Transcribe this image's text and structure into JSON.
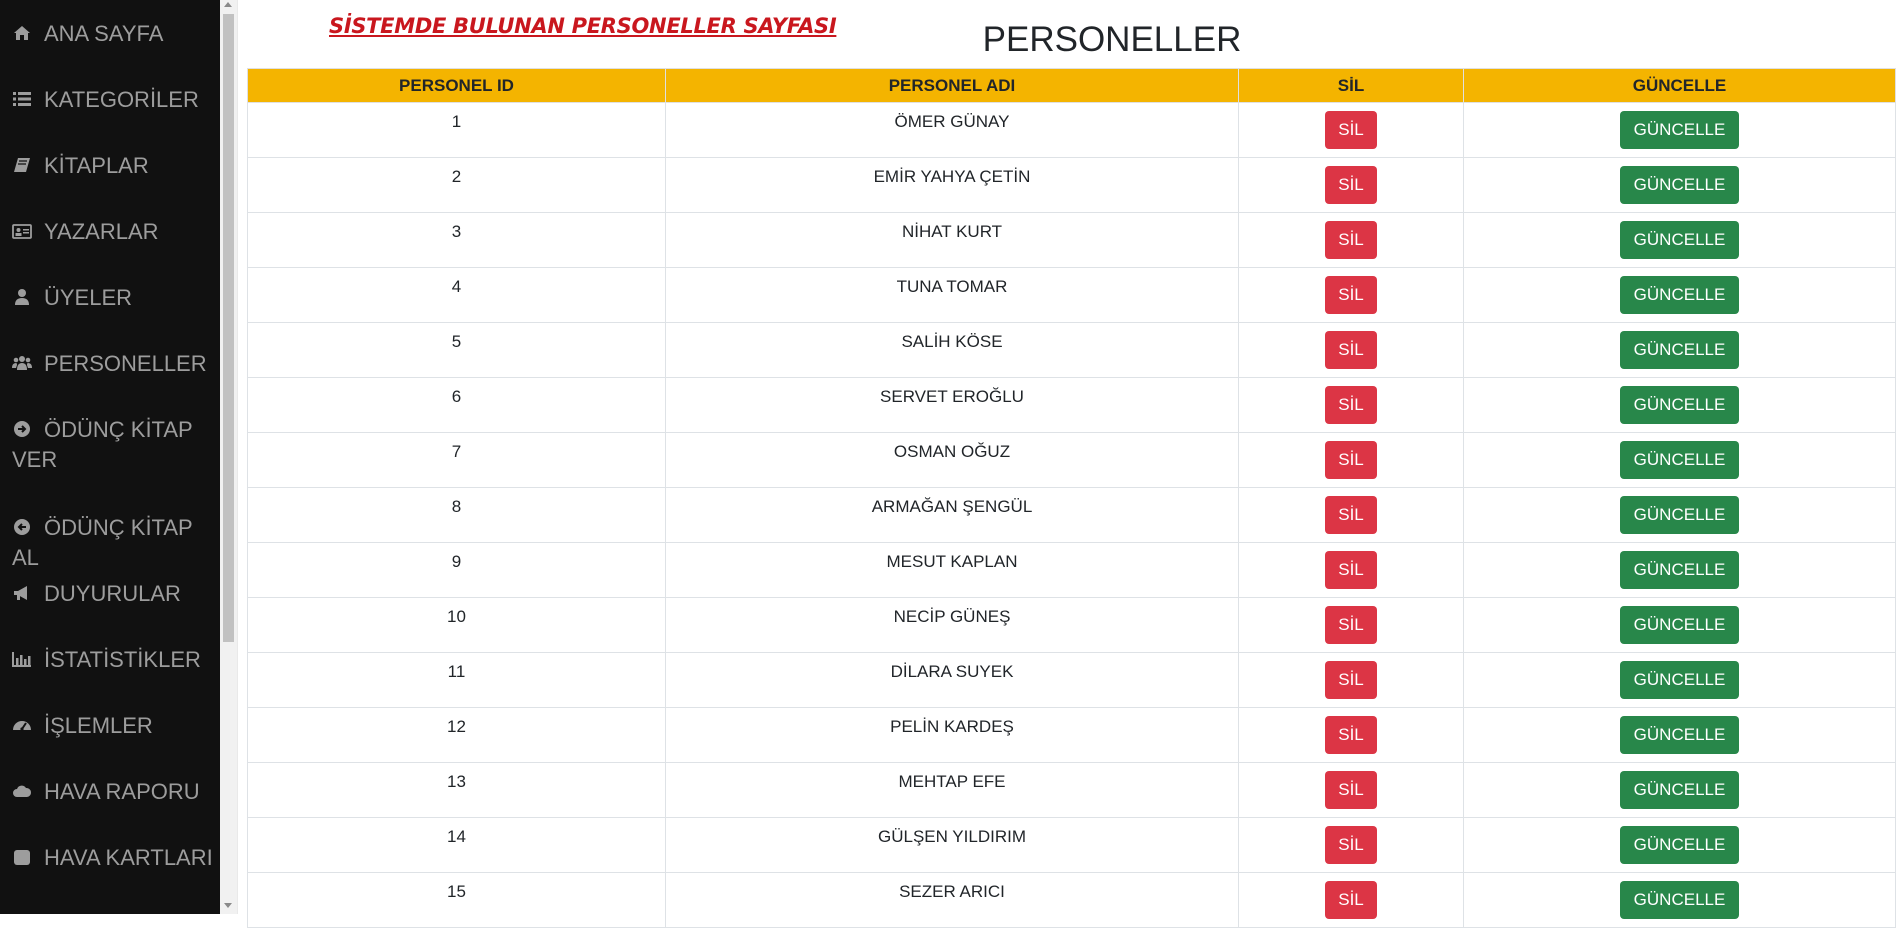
{
  "sidebar": {
    "items": [
      {
        "label": "ANA SAYFA",
        "icon": "home-icon"
      },
      {
        "label": "KATEGORİLER",
        "icon": "list-icon"
      },
      {
        "label": "KİTAPLAR",
        "icon": "book-icon"
      },
      {
        "label": "YAZARLAR",
        "icon": "id-card-icon"
      },
      {
        "label": "ÜYELER",
        "icon": "user-icon"
      },
      {
        "label": "PERSONELLER",
        "icon": "users-icon"
      },
      {
        "label": "ÖDÜNÇ KİTAP VER",
        "icon": "arrow-circle-right-icon"
      },
      {
        "label": "ÖDÜNÇ KİTAP AL",
        "icon": "arrow-circle-left-icon"
      },
      {
        "label": "DUYURULAR",
        "icon": "bullhorn-icon"
      },
      {
        "label": "İSTATİSTİKLER",
        "icon": "bar-chart-icon"
      },
      {
        "label": "İŞLEMLER",
        "icon": "dashboard-icon"
      },
      {
        "label": "HAVA RAPORU",
        "icon": "cloud-icon"
      },
      {
        "label": "HAVA KARTLARI",
        "icon": "square-icon"
      }
    ]
  },
  "header": {
    "subtitle": "SİSTEMDE BULUNAN PERSONELLER SAYFASI",
    "title": "PERSONELLER"
  },
  "table": {
    "columns": [
      "PERSONEL ID",
      "PERSONEL ADI",
      "SİL",
      "GÜNCELLE"
    ],
    "delete_label": "SİL",
    "update_label": "GÜNCELLE",
    "rows": [
      {
        "id": "1",
        "name": "ÖMER GÜNAY"
      },
      {
        "id": "2",
        "name": "EMİR YAHYA ÇETİN"
      },
      {
        "id": "3",
        "name": "NİHAT KURT"
      },
      {
        "id": "4",
        "name": "TUNA TOMAR"
      },
      {
        "id": "5",
        "name": "SALİH KÖSE"
      },
      {
        "id": "6",
        "name": "SERVET EROĞLU"
      },
      {
        "id": "7",
        "name": "OSMAN OĞUZ"
      },
      {
        "id": "8",
        "name": "ARMAĞAN ŞENGÜL"
      },
      {
        "id": "9",
        "name": "MESUT KAPLAN"
      },
      {
        "id": "10",
        "name": "NECİP GÜNEŞ"
      },
      {
        "id": "11",
        "name": "DİLARA SUYEK"
      },
      {
        "id": "12",
        "name": "PELİN KARDEŞ"
      },
      {
        "id": "13",
        "name": "MEHTAP EFE"
      },
      {
        "id": "14",
        "name": "GÜLŞEN YILDIRIM"
      },
      {
        "id": "15",
        "name": "SEZER ARICI"
      }
    ]
  },
  "colors": {
    "sidebar_bg": "#111111",
    "sidebar_text": "#9d9d9d",
    "table_header_bg": "#f4b400",
    "subtitle_color": "#c9171e",
    "delete_button": "#dc3545",
    "update_button": "#28874a"
  }
}
